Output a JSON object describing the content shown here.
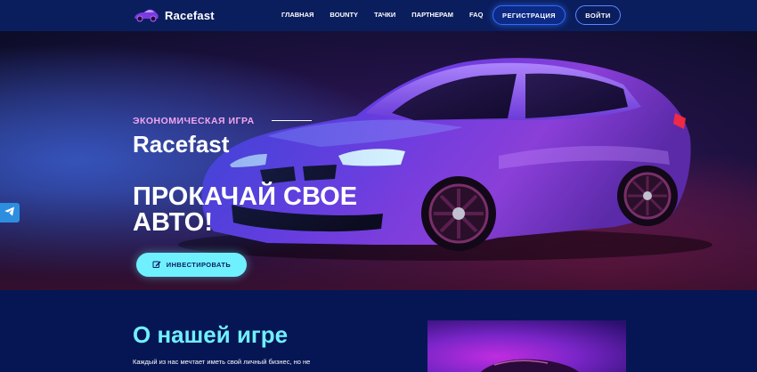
{
  "header": {
    "brand": "Racefast",
    "nav": [
      "Главная",
      "BOUNTY",
      "Тачки",
      "Партнерам",
      "FAQ"
    ],
    "register_label": "РЕГИСТРАЦИЯ",
    "login_label": "ВОЙТИ"
  },
  "hero": {
    "eyebrow": "ЭКОНОМИЧЕСКАЯ ИГРА",
    "title": "Racefast",
    "tagline": "ПРОКАЧАЙ СВОЕ АВТО!",
    "cta_label": "ИНВЕСТИРОВАТЬ"
  },
  "about": {
    "title": "О нашей игре",
    "text": "Каждый из нас мечтает иметь свой личный бизнес, но не"
  },
  "colors": {
    "header_bg": "#0a1e5e",
    "accent_cyan": "#6ff0ff",
    "eyebrow_pink": "#f2a6f0",
    "section_bg": "#061654",
    "telegram": "#2d8ee0"
  },
  "icons": {
    "telegram": "telegram-icon",
    "invest": "edit-icon",
    "logo": "car-logo-icon"
  }
}
